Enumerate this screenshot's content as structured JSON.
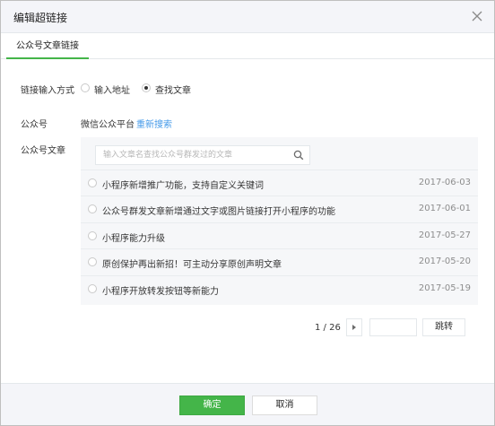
{
  "dialog": {
    "title": "编辑超链接",
    "close_icon": "close-icon"
  },
  "tabs": [
    {
      "label": "公众号文章链接",
      "active": true
    }
  ],
  "link_method": {
    "label": "链接输入方式",
    "options": [
      {
        "label": "输入地址",
        "selected": false
      },
      {
        "label": "查找文章",
        "selected": true
      }
    ]
  },
  "account": {
    "label": "公众号",
    "name": "微信公众平台",
    "research_label": "重新搜索"
  },
  "articles": {
    "label": "公众号文章",
    "search_placeholder": "输入文章名查找公众号群发过的文章",
    "search_icon": "search-icon",
    "items": [
      {
        "title": "小程序新增推广功能，支持自定义关键词",
        "date": "2017-06-03"
      },
      {
        "title": "公众号群发文章新增通过文字或图片链接打开小程序的功能",
        "date": "2017-06-01"
      },
      {
        "title": "小程序能力升级",
        "date": "2017-05-27"
      },
      {
        "title": "原创保护再出新招！可主动分享原创声明文章",
        "date": "2017-05-20"
      },
      {
        "title": "小程序开放转发按钮等新能力",
        "date": "2017-05-19"
      }
    ]
  },
  "pagination": {
    "text": "1 / 26",
    "page_input_value": "",
    "jump_label": "跳转"
  },
  "footer": {
    "ok_label": "确定",
    "cancel_label": "取消"
  },
  "colors": {
    "accent": "#44b549",
    "link": "#459ae9"
  }
}
